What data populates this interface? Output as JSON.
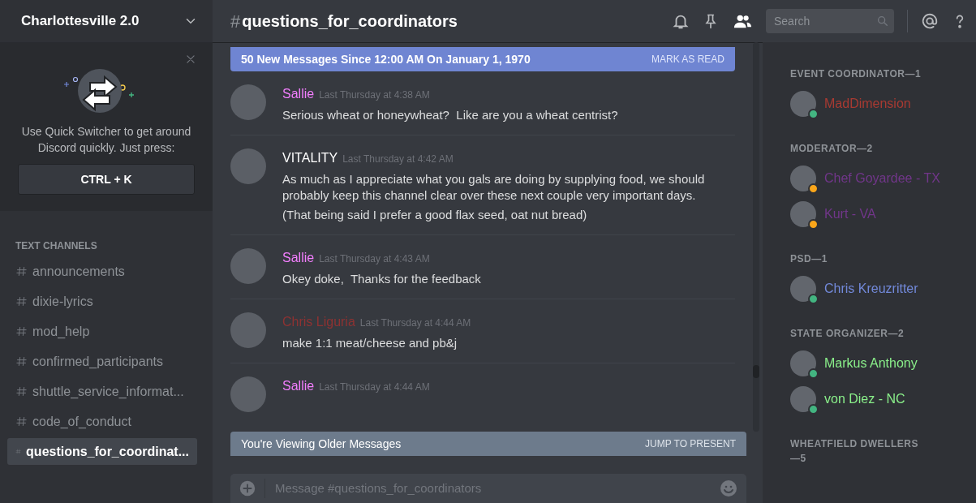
{
  "server": {
    "name": "Charlottesville 2.0"
  },
  "quick_switcher": {
    "text": "Use Quick Switcher to get around Discord quickly. Just press:",
    "shortcut": "CTRL + K"
  },
  "channel_group": {
    "title": "TEXT CHANNELS",
    "channels": [
      {
        "name": "announcements",
        "selected": false
      },
      {
        "name": "dixie-lyrics",
        "selected": false
      },
      {
        "name": "mod_help",
        "selected": false
      },
      {
        "name": "confirmed_participants",
        "selected": false
      },
      {
        "name": "shuttle_service_informat...",
        "selected": false
      },
      {
        "name": "code_of_conduct",
        "selected": false
      },
      {
        "name": "questions_for_coordinat...",
        "selected": true
      }
    ]
  },
  "channel_header": {
    "hash": "#",
    "title": "questions_for_coordinators",
    "search_placeholder": "Search"
  },
  "new_messages_bar": {
    "text": "50 New Messages Since 12:00 AM On January 1, 1970",
    "action": "MARK AS READ"
  },
  "messages": [
    {
      "author": "Sallie",
      "color": "#f47fff",
      "time": "Last Thursday at 4:38 AM",
      "lines": [
        "Serious wheat or honeywheat?  Like are you a wheat centrist?"
      ]
    },
    {
      "author": "VITALITY",
      "color": "#ffffff",
      "time": "Last Thursday at 4:42 AM",
      "lines": [
        "As much as I appreciate what you gals are doing by supplying food, we should probably keep this channel clear over these next couple very important days.",
        "(That being said I prefer a good flax seed, oat nut bread)"
      ]
    },
    {
      "author": "Sallie",
      "color": "#f47fff",
      "time": "Last Thursday at 4:43 AM",
      "lines": [
        "Okey doke,  Thanks for the feedback"
      ]
    },
    {
      "author": "Chris Liguria",
      "color": "#8e3232",
      "time": "Last Thursday at 4:44 AM",
      "lines": [
        "make 1:1 meat/cheese and pb&j"
      ]
    },
    {
      "author": "Sallie",
      "color": "#f47fff",
      "time": "Last Thursday at 4:44 AM"
    }
  ],
  "older_bar": {
    "text": "You're Viewing Older Messages",
    "action": "JUMP TO PRESENT"
  },
  "composer": {
    "placeholder": "Message #questions_for_coordinators"
  },
  "member_groups": [
    {
      "title": "EVENT COORDINATOR—1",
      "color": "#a83a32",
      "members": [
        {
          "name": "MadDimension",
          "color": "#43b581"
        }
      ]
    },
    {
      "title": "MODERATOR—2",
      "color": "#71368a",
      "members": [
        {
          "name": "Chef Goyardee - TX",
          "color": "#faa61a"
        },
        {
          "name": "Kurt - VA",
          "color": "#faa61a"
        }
      ]
    },
    {
      "title": "PSD—1",
      "color": "#7289da",
      "members": [
        {
          "name": "Chris Kreuzritter",
          "color": "#43b581"
        }
      ]
    },
    {
      "title": "STATE ORGANIZER—2",
      "color": "#8af08a",
      "members": [
        {
          "name": "Markus Anthony",
          "color": "#43b581"
        },
        {
          "name": "von Diez - NC",
          "color": "#43b581"
        }
      ]
    },
    {
      "title": "WHEATFIELD DWELLERS—5"
    }
  ]
}
